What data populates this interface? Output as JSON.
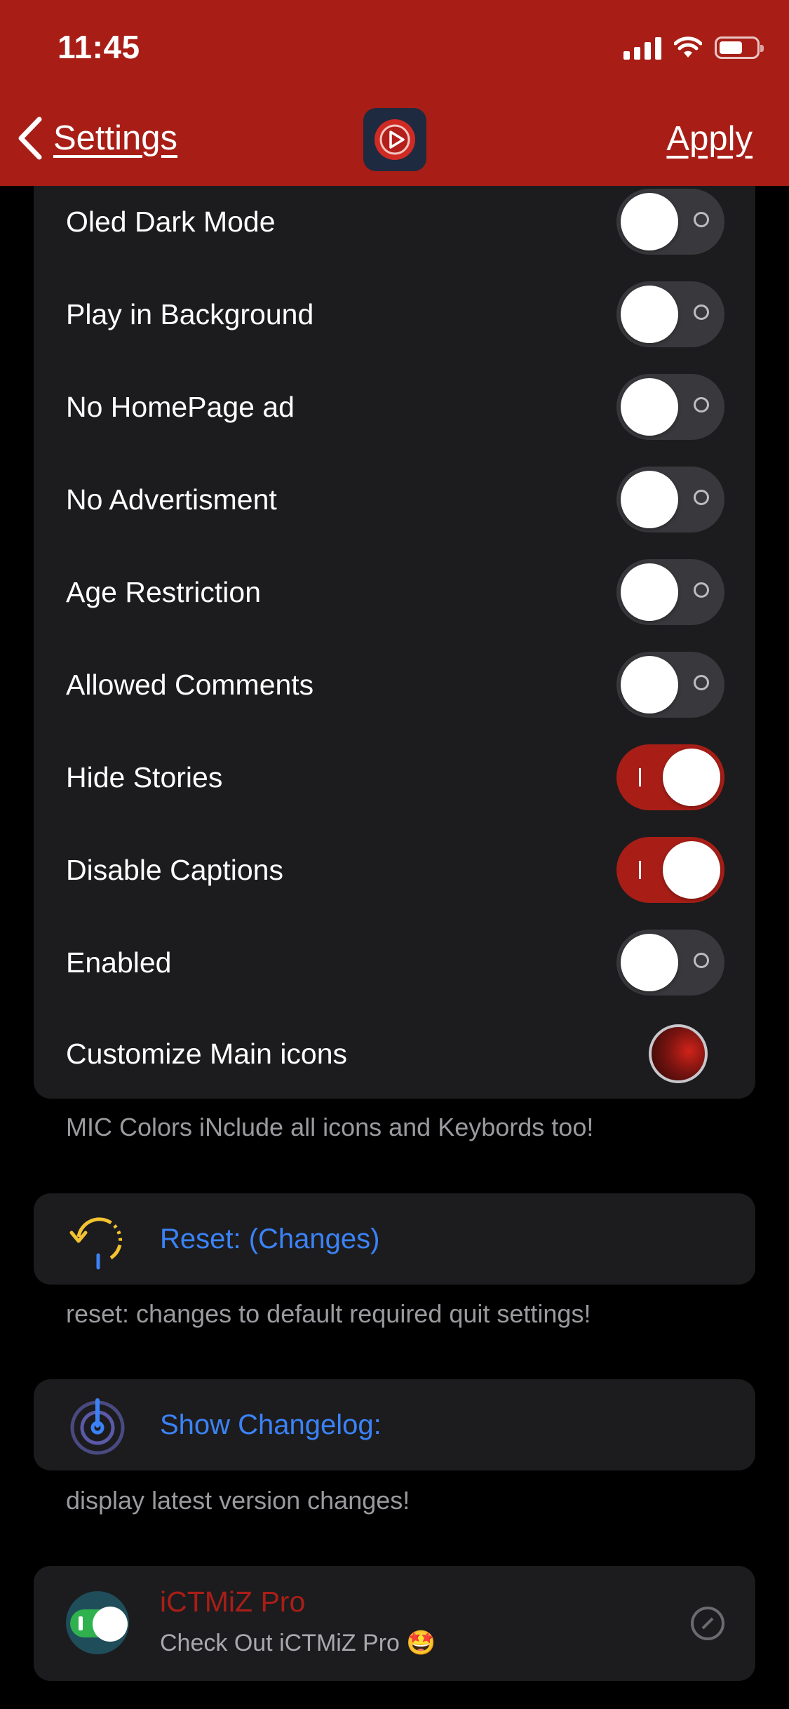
{
  "status_bar": {
    "time": "11:45"
  },
  "nav": {
    "back_label": "Settings",
    "apply_label": "Apply"
  },
  "toggles": [
    {
      "label": "Oled Dark Mode",
      "on": false
    },
    {
      "label": "Play in Background",
      "on": false
    },
    {
      "label": "No HomePage ad",
      "on": false
    },
    {
      "label": "No Advertisment",
      "on": false
    },
    {
      "label": "Age Restriction",
      "on": false
    },
    {
      "label": "Allowed Comments",
      "on": false
    },
    {
      "label": "Hide Stories",
      "on": true
    },
    {
      "label": "Disable Captions",
      "on": true
    },
    {
      "label": "Enabled",
      "on": false
    }
  ],
  "customize": {
    "label": "Customize Main icons",
    "color": "#a81e17"
  },
  "footnotes": {
    "colors": "MIC Colors iNclude all icons and Keybords too!",
    "reset": "reset: changes to default required quit settings!",
    "changelog": "display latest version changes!"
  },
  "actions": {
    "reset_label": "Reset: (Changes)",
    "changelog_label": "Show Changelog:"
  },
  "promo": {
    "title": "iCTMiZ Pro",
    "subtitle": "Check Out iCTMiZ Pro 🤩"
  },
  "colors": {
    "accent": "#a81e17",
    "link": "#3b82f6",
    "cell": "#1c1c1e"
  }
}
